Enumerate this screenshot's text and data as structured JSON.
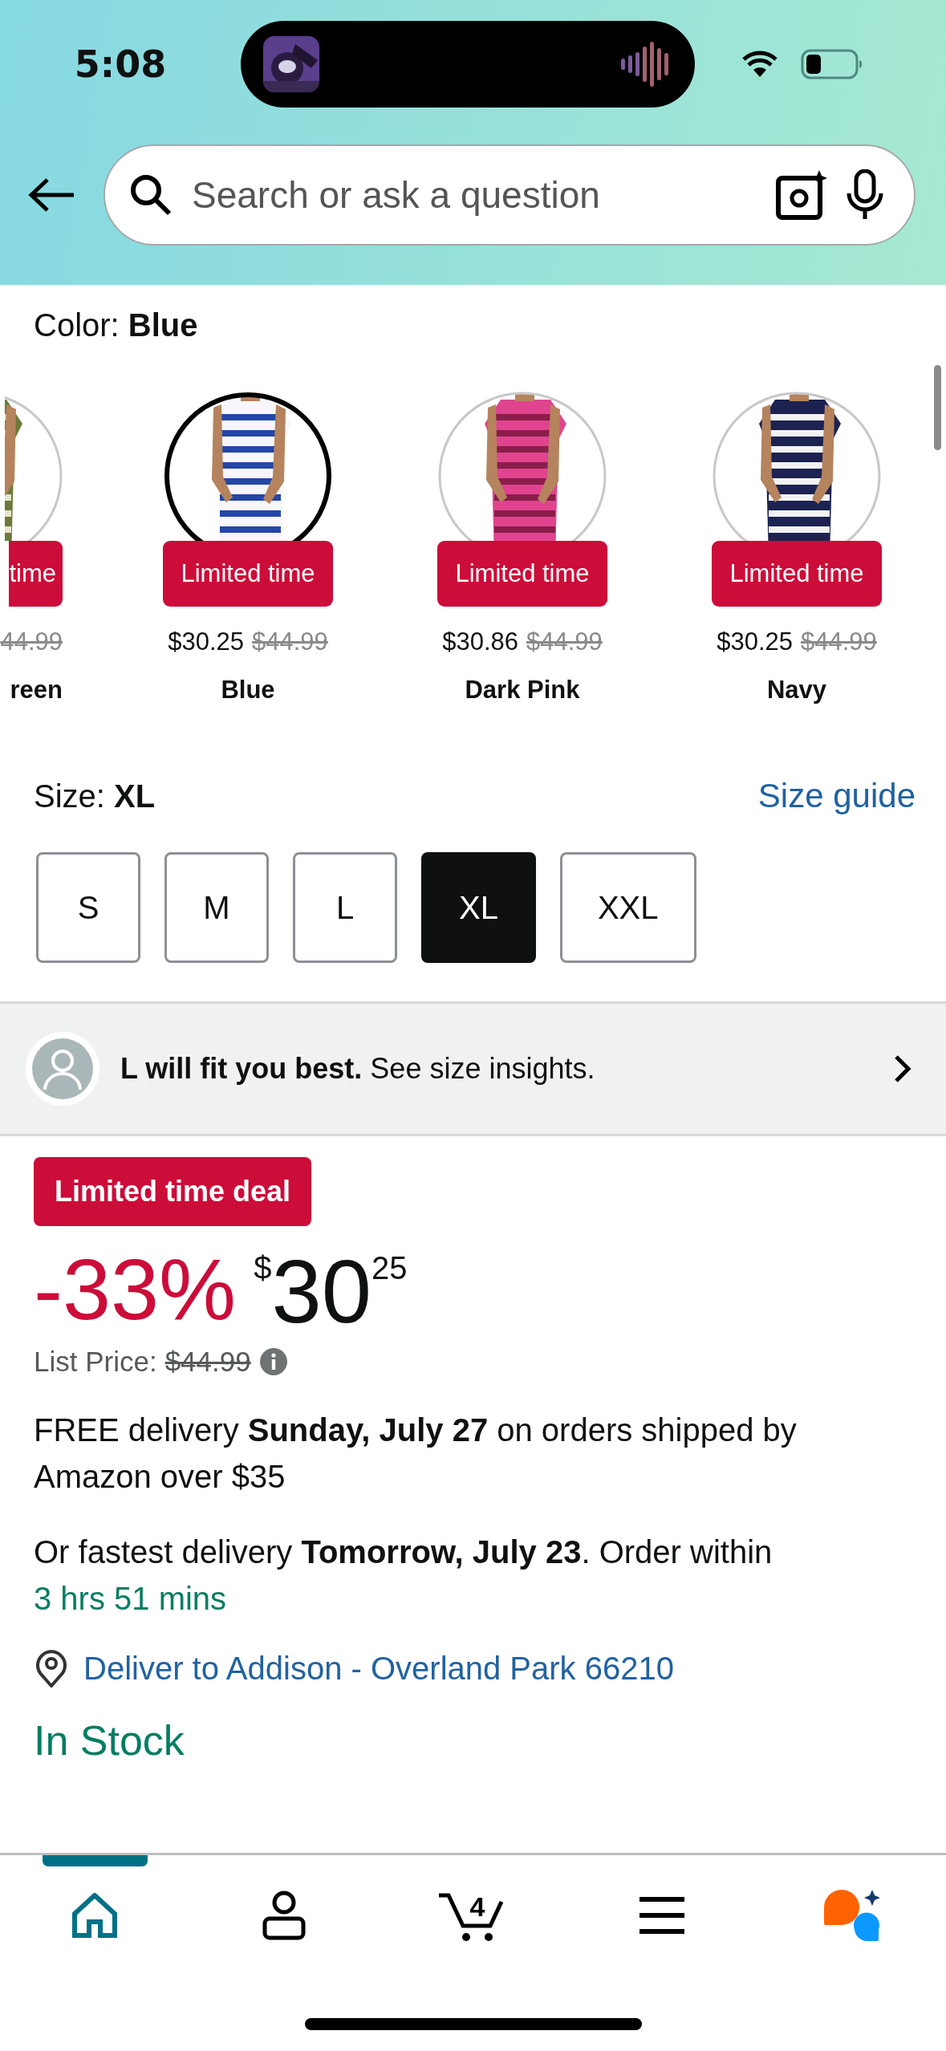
{
  "status_bar": {
    "time": "5:08"
  },
  "search": {
    "placeholder": "Search or ask a question"
  },
  "color": {
    "label": "Color:",
    "value": "Blue"
  },
  "swatches": [
    {
      "kind": "partial",
      "badge": "time",
      "list_price": "44.99",
      "name": "reen",
      "selected": false
    },
    {
      "kind": "full",
      "badge": "Limited time",
      "price": "$30.25",
      "list_price": "$44.99",
      "name": "Blue",
      "selected": true
    },
    {
      "kind": "full",
      "badge": "Limited time",
      "price": "$30.86",
      "list_price": "$44.99",
      "name": "Dark Pink",
      "selected": false
    },
    {
      "kind": "full",
      "badge": "Limited time",
      "price": "$30.25",
      "list_price": "$44.99",
      "name": "Navy",
      "selected": false
    }
  ],
  "size": {
    "label": "Size:",
    "value": "XL",
    "guide": "Size guide"
  },
  "sizes": [
    {
      "label": "S",
      "selected": false
    },
    {
      "label": "M",
      "selected": false
    },
    {
      "label": "L",
      "selected": false
    },
    {
      "label": "XL",
      "selected": true
    },
    {
      "label": "XXL",
      "selected": false
    }
  ],
  "fit": {
    "text": "**L will fit you best.** See size insights."
  },
  "deal": {
    "badge": "Limited time deal",
    "discount": "-33%",
    "currency": "$",
    "whole": "30",
    "fraction": "25",
    "list_label": "List Price:",
    "list_price": "$44.99"
  },
  "delivery": {
    "free": "FREE delivery **Sunday, July 27** on orders shipped by Amazon over $35",
    "fastest": "Or fastest delivery **Tomorrow, July 23**. Order within",
    "countdown": "3 hrs 51 mins",
    "location": "Deliver to Addison - Overland Park 66210"
  },
  "stock": "In Stock",
  "nav": [
    {
      "kind": "home",
      "selected": true
    },
    {
      "kind": "account",
      "selected": false
    },
    {
      "kind": "cart",
      "selected": false,
      "count": "4"
    },
    {
      "kind": "menu",
      "selected": false
    },
    {
      "kind": "assistant",
      "selected": false
    }
  ]
}
